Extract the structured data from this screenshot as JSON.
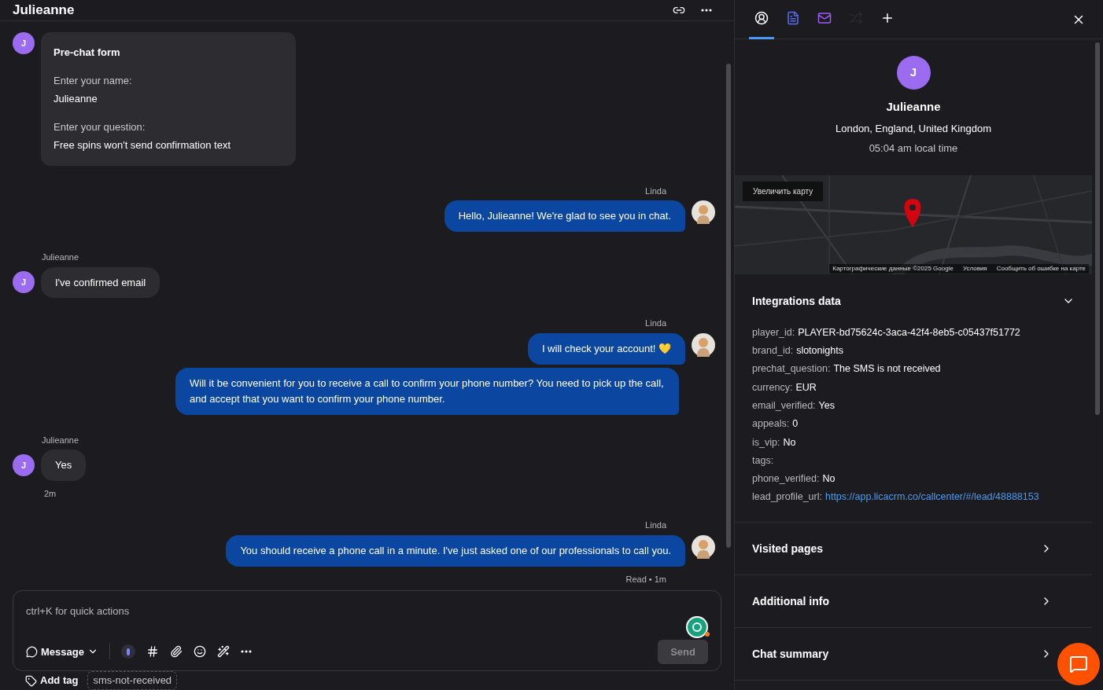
{
  "header": {
    "title": "Julieanne"
  },
  "messages": [
    {
      "kind": "form",
      "avatar": "J",
      "title": "Pre-chat form",
      "fields": [
        {
          "label": "Enter your name:",
          "value": "Julieanne"
        },
        {
          "label": "Enter your question:",
          "value": "Free spins won't send confirmation text"
        }
      ]
    },
    {
      "kind": "agent",
      "author": "Linda",
      "text": "Hello, Julieanne! We're glad to see you in chat."
    },
    {
      "kind": "visitor",
      "author": "Julieanne",
      "avatar": "J",
      "text": "I've confirmed email"
    },
    {
      "kind": "agent",
      "author": "Linda",
      "text": "I will check your account! 💛"
    },
    {
      "kind": "agent_cont",
      "text": "Will it be convenient for you to receive a call to confirm your phone number? You need to pick up the call, and accept that you want to confirm your phone number."
    },
    {
      "kind": "visitor",
      "author": "Julieanne",
      "avatar": "J",
      "text": "Yes",
      "time": "2m"
    },
    {
      "kind": "agent",
      "author": "Linda",
      "text": "You should receive a phone call in a minute. I've just asked one of our professionals to call you.",
      "status": "Read • 1m"
    }
  ],
  "composer": {
    "placeholder": "ctrl+K for quick actions",
    "mode": "Message",
    "send": "Send",
    "send_disabled": true
  },
  "tags": {
    "add": "Add tag",
    "items": [
      "sms-not-received"
    ]
  },
  "side_tabs": [
    {
      "kind": "profile",
      "selected": true
    },
    {
      "kind": "doc",
      "selected": false
    },
    {
      "kind": "mail",
      "selected": false
    },
    {
      "kind": "shuffle",
      "selected": false
    },
    {
      "kind": "add",
      "selected": false
    }
  ],
  "profile": {
    "avatar": "J",
    "name": "Julieanne",
    "location": "London, England, United Kingdom",
    "local_time": "05:04 am local time"
  },
  "map": {
    "enlarge": "Увеличить карту",
    "attribution": [
      "Картографические данные ©2025 Google",
      "Условия",
      "Сообщить об ошибке на карте"
    ]
  },
  "integrations": {
    "title": "Integrations data",
    "expanded": true,
    "rows": [
      {
        "key": "player_id:",
        "value": "PLAYER-bd75624c-3aca-42f4-8eb5-c05437f51772"
      },
      {
        "key": "brand_id:",
        "value": "slotonights"
      },
      {
        "key": "prechat_question:",
        "value": "The SMS is not received"
      },
      {
        "key": "currency:",
        "value": "EUR"
      },
      {
        "key": "email_verified:",
        "value": "Yes"
      },
      {
        "key": "appeals:",
        "value": "0"
      },
      {
        "key": "is_vip:",
        "value": "No"
      },
      {
        "key": "tags:"
      },
      {
        "key": "phone_verified:",
        "value": "No"
      },
      {
        "key": "lead_profile_url:",
        "value": "https://app.licacrm.co/callcenter/#/lead/48888153",
        "kind": "link"
      }
    ]
  },
  "sections": [
    {
      "title": "Visited pages",
      "expanded": false
    },
    {
      "title": "Additional info",
      "expanded": false
    },
    {
      "title": "Chat summary",
      "expanded": false
    }
  ]
}
